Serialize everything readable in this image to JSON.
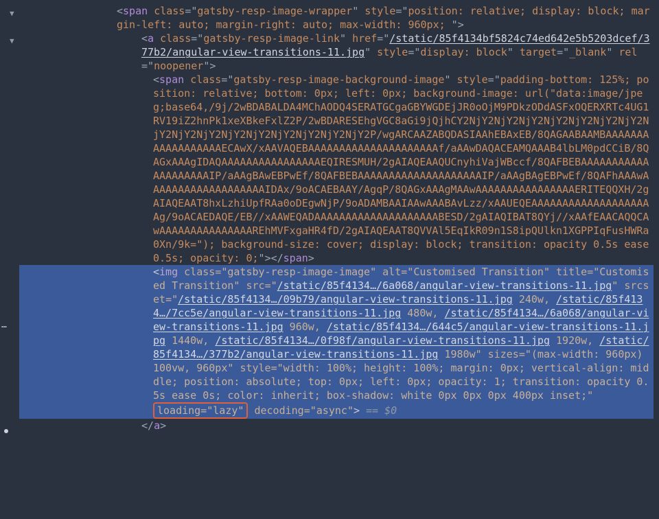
{
  "gutter": {
    "ellipsis": "…"
  },
  "line1": {
    "tag": "span",
    "attr_class_name": "class",
    "attr_class_val": "gatsby-resp-image-wrapper",
    "attr_style_name": "style",
    "attr_style_val": "position: relative; display: block; margin-left: auto; margin-right: auto; max-width: 960px; "
  },
  "line2": {
    "tag": "a",
    "attr_class_name": "class",
    "attr_class_val": "gatsby-resp-image-link",
    "attr_href_name": "href",
    "attr_href_val": "/static/85f4134bf5824c74ed642e5b5203dcef/377b2/angular-view-transitions-11.jpg",
    "attr_style_name": "style",
    "attr_style_val": "display: block",
    "attr_target_name": "target",
    "attr_target_val": "_blank",
    "attr_rel_name": "rel",
    "attr_rel_val": "noopener"
  },
  "line3": {
    "tag": "span",
    "attr_class_name": "class",
    "attr_class_val": "gatsby-resp-image-background-image",
    "attr_style_name": "style",
    "style_chunk_a": "padding-bottom: 125%; position: relative; bottom: 0px; left: 0px; background-image: url(\"data:image/jpeg;base64,/9j/2wBDABALDA4MChAODQ4SERATGCgaGBYWGDEjJR0oOjM9PDkzODdASFxOQERXRTc4UG1RV19iZ2hnPk1xeXBkeFxlZ2P/2wBDARESEhgVGC8aGi9jQjhCY2NjY2NjY2NjY2NjY2NjY2NjY2NjY2NjY2NjY2NjY2NjY2NjY2NjY2NjY2NjY2NjY2P/wgARCAAZABQDASIAAhEBAxEB/8QAGAABAAMBAAAAAAAAAAAAAAAAAAECAwX/xAAVAQEBAAAAAAAAAAAAAAAAAAAAAf/aAAwDAQACEAMQAAAB4lbLM0pdCCiB/8QAGxAAAgIDAQAAAAAAAAAAAAAAAAEQIRESMUH/2gAIAQEAAQUCnyhiVajWBccf/8QAFBEBAAAAAAAAAAAAAAAAAAAAIP/aAAgBAwEBPwEf/8QAFBEBAAAAAAAAAAAAAAAAAAAAIP/aAAgBAgEBPwEf/8QAFhAAAwAAAAAAAAAAAAAAAAAAAIDAx/9oACAEBAAY/AgqP/8QAGxAAAgMAAwAAAAAAAAAAAAAAAAERITEQQXH/2gAIAQEAAT8hxLzhiUpfRAa0oDEgwNjP/9oADAMBAAIAAwAAABAvLzz/xAAUEQEAAAAAAAAAAAAAAAAAAAAg/9oACAEDAQE/EB//xAAWEQADAAAAAAAAAAAAAAAAAAAABESD/2gAIAQIBAT8QYj//xAAfEAACAQQCAwAAAAAAAAAAAAAAAREhMVFxgaHR4fD/2gAIAQEAAT8QVVAl5EqIkR09n1S8ipQUlkn1XGPPIqFusHWRa0Xn/9k=\"); background-size: cover; display: block; transition: opacity 0.5s ease 0.5s; opacity: 0;",
    "close_tag": "span"
  },
  "img": {
    "tag": "img",
    "attr_class_name": "class",
    "attr_class_val": "gatsby-resp-image-image",
    "attr_alt_name": "alt",
    "attr_alt_val": "Customised Transition",
    "attr_title_name": "title",
    "attr_title_val": "Customised Transition",
    "attr_src_name": "src",
    "src_url": "/static/85f4134…/6a068/angular-view-transitions-11.jpg",
    "attr_srcset_name": "srcset",
    "srcset1_url": "/static/85f4134…/09b79/angular-view-transitions-11.jpg",
    "srcset1_size": " 240w, ",
    "srcset2_url": "/static/85f4134…/7cc5e/angular-view-transitions-11.jpg",
    "srcset2_size": " 480w, ",
    "srcset3_url": "/static/85f4134…/6a068/angular-view-transitions-11.jpg",
    "srcset3_size": " 960w, ",
    "srcset4_url": "/static/85f4134…/644c5/angular-view-transitions-11.jpg",
    "srcset4_size": " 1440w, ",
    "srcset5_url": "/static/85f4134…/0f98f/angular-view-transitions-11.jpg",
    "srcset5_size": " 1920w, ",
    "srcset6_url": "/static/85f4134…/377b2/angular-view-transitions-11.jpg",
    "srcset6_size": " 1980w\" ",
    "attr_sizes_name": "sizes",
    "attr_sizes_val": "(max-width: 960px) 100vw, 960px",
    "attr_style_name": "style",
    "attr_style_val": "width: 100%; height: 100%; margin: 0px; vertical-align: middle; position: absolute; top: 0px; left: 0px; opacity: 1; transition: opacity 0.5s ease 0s; color: inherit; box-shadow: white 0px 0px 0px 400px inset;",
    "loading_pair": "loading=\"lazy\"",
    "attr_decoding_name": "decoding",
    "attr_decoding_val": "async",
    "eq_zero": " == $0"
  },
  "closeA": {
    "tag": "a"
  }
}
